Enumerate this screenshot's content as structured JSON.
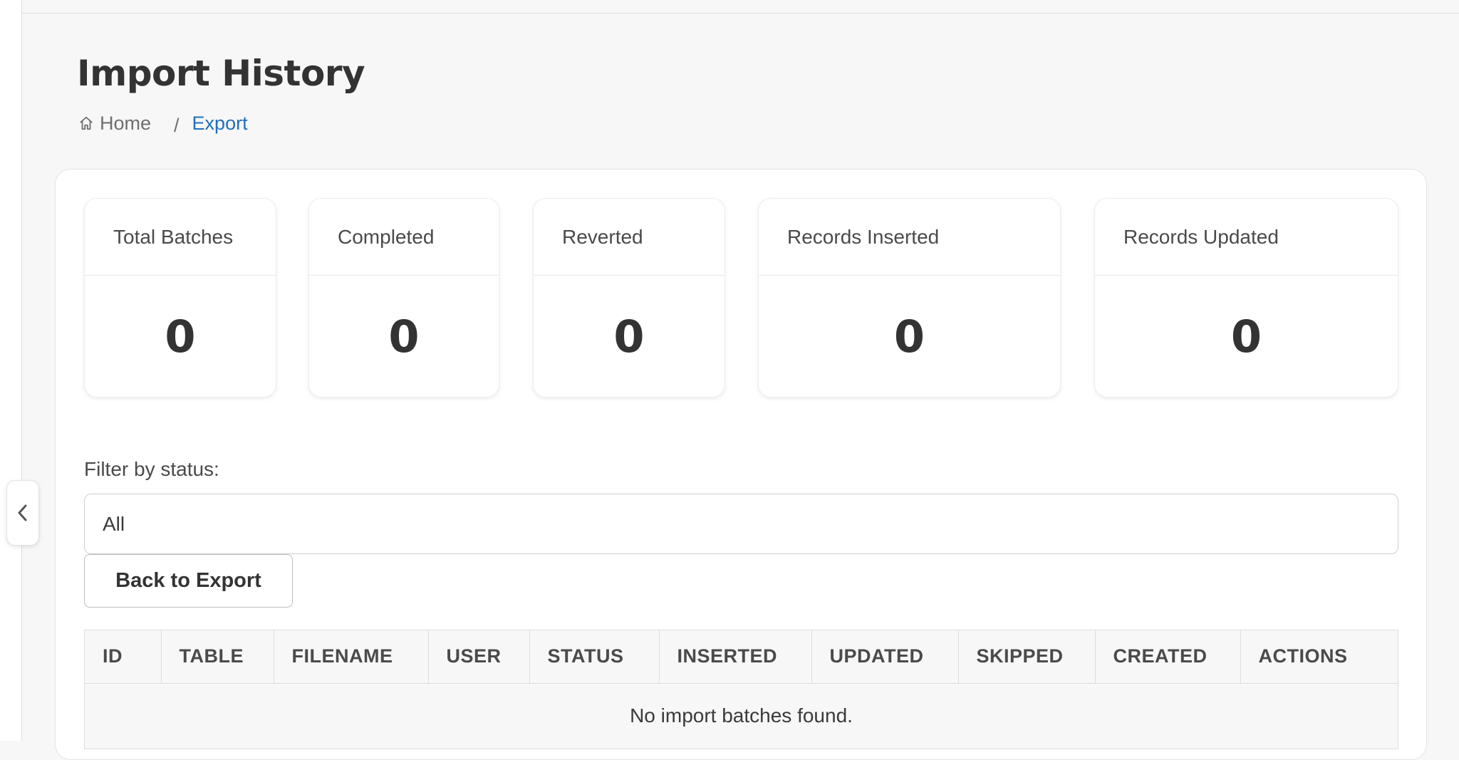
{
  "page": {
    "title": "Import History"
  },
  "breadcrumb": {
    "home_label": "Home",
    "separator": "/",
    "current_label": "Export"
  },
  "stats": [
    {
      "label": "Total Batches",
      "value": "0"
    },
    {
      "label": "Completed",
      "value": "0"
    },
    {
      "label": "Reverted",
      "value": "0"
    },
    {
      "label": "Records Inserted",
      "value": "0"
    },
    {
      "label": "Records Updated",
      "value": "0"
    }
  ],
  "filter": {
    "label": "Filter by status:",
    "selected": "All"
  },
  "actions": {
    "back_label": "Back to Export"
  },
  "table": {
    "columns": [
      "ID",
      "TABLE",
      "FILENAME",
      "USER",
      "STATUS",
      "INSERTED",
      "UPDATED",
      "SKIPPED",
      "CREATED",
      "ACTIONS"
    ],
    "empty_message": "No import batches found."
  },
  "colors": {
    "link": "#1f6fbd",
    "background": "#f7f7f7",
    "panel": "#ffffff"
  },
  "icons": {
    "home": "home-icon",
    "collapse": "chevron-left-icon"
  }
}
